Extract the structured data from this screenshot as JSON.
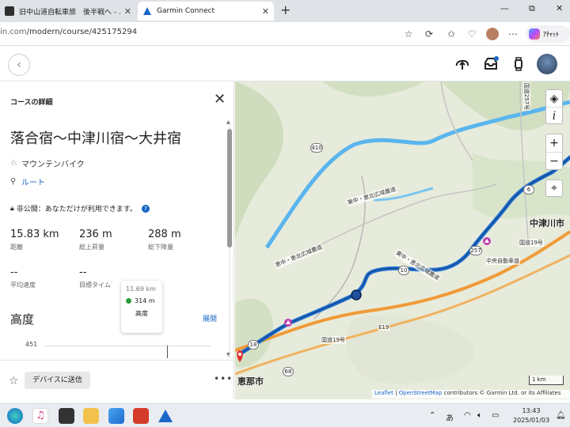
{
  "browser": {
    "tabs": [
      {
        "title": "旧中山道自転車旅　後半戦へ - ...",
        "active": false
      },
      {
        "title": "Garmin Connect",
        "active": true
      }
    ],
    "new_tab_label": "+",
    "window_controls": {
      "minimize": "—",
      "maximize": "⧉",
      "close": "✕"
    },
    "url_prefix": "in.com",
    "url_path": "/modern/course/425175294",
    "copilot_label": "ｱﾁｬｯﾄ"
  },
  "panel": {
    "header": "コースの詳細",
    "course_name": "落合宿～中津川宿～大井宿",
    "activity_type": "マウンテンバイク",
    "route_label": "ルート",
    "privacy": "非公開：あなただけが利用できます。",
    "stats": [
      {
        "value": "15.83 km",
        "label": "距離"
      },
      {
        "value": "236 m",
        "label": "総上昇量"
      },
      {
        "value": "288 m",
        "label": "総下降量"
      },
      {
        "value": "--",
        "label": "平均速度"
      },
      {
        "value": "--",
        "label": "目標タイム"
      }
    ],
    "elevation_title": "高度",
    "expand_label": "展開",
    "tooltip": {
      "distance": "11.69 km",
      "elevation": "314 m",
      "label": "高度"
    },
    "chart_y_tick": "451",
    "send_button": "デバイスに送信",
    "more_label": "•••"
  },
  "map": {
    "places": [
      "中津川市",
      "恵那市"
    ],
    "road_labels": [
      "東中・恵北広域農道",
      "東中・恵北広域農道",
      "恵中・恵北広域農道",
      "中央自動車道",
      "国道19号",
      "国道19号",
      "E19",
      "国道257号"
    ],
    "route_numbers": [
      "10",
      "18",
      "68",
      "6",
      "410",
      "257"
    ],
    "zoom_in": "+",
    "zoom_out": "−",
    "info_label": "i",
    "scale": "1 km",
    "attribution_leaflet": "Leaflet",
    "attribution_osm": "OpenStreetMap",
    "attribution_rest": " contributors © Garmin Ltd. or its Affiliates",
    "colors": {
      "route": "#1f6fd1",
      "highway": "#f09a38",
      "river": "#5ab5ee",
      "terrain": "#d7e4c9"
    }
  },
  "taskbar": {
    "ime": "あ",
    "time": "13:43",
    "date": "2025/01/03"
  }
}
